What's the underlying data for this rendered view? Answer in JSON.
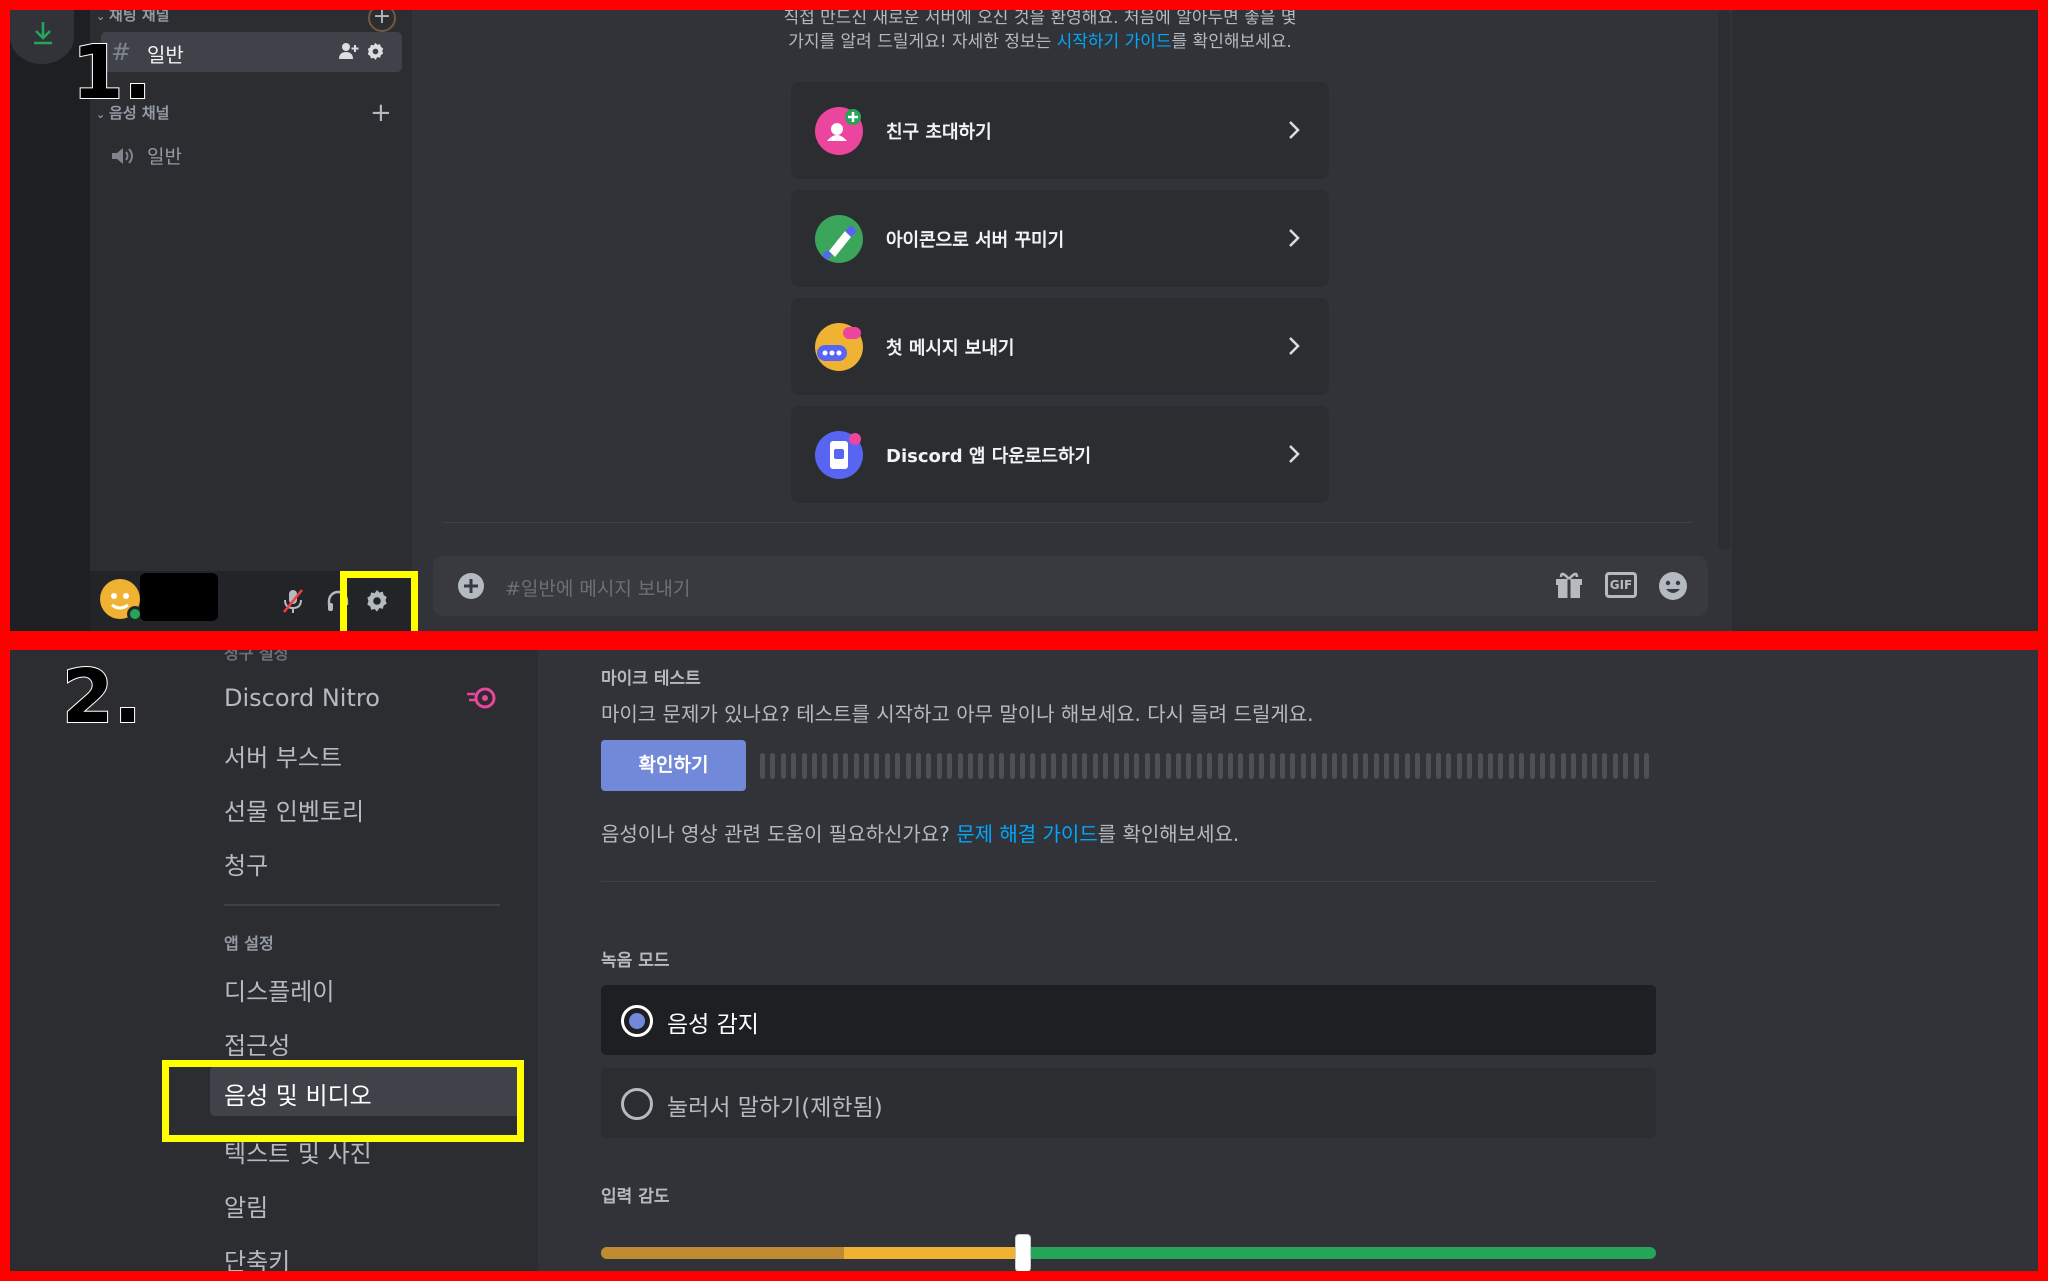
{
  "steps": {
    "one": "1.",
    "two": "2."
  },
  "colors": {
    "frame": "#ff0000",
    "highlight": "#ffff00",
    "accent": "#7289da",
    "link": "#00a8fc",
    "green": "#23a55a"
  },
  "channel_sidebar": {
    "text_category": "채팅 채널",
    "text_channel": "일반",
    "voice_category": "음성 채널",
    "voice_channel": "일반",
    "icons": [
      "download-icon",
      "hash-icon",
      "add-member-icon",
      "gear-icon",
      "plus-icon",
      "speaker-icon"
    ]
  },
  "user_panel": {
    "icons": [
      "avatar",
      "mute-mic-icon",
      "headphones-icon",
      "settings-gear-icon"
    ]
  },
  "chat": {
    "welcome_line1": "직접 만드신 새로운 서버에 오신 것을 환영해요. 처음에 알아두면 좋을 몇",
    "welcome_line2_pre": "가지를 알려   드릴게요! 자세한 정보는 ",
    "welcome_link": "시작하기 가이드",
    "welcome_line2_post": "를 확인해보세요.",
    "cards": [
      {
        "label": "친구 초대하기",
        "icon": "invite-friend-icon"
      },
      {
        "label": "아이콘으로 서버 꾸미기",
        "icon": "customize-server-icon"
      },
      {
        "label": "첫 메시지 보내기",
        "icon": "first-message-icon"
      },
      {
        "label": "Discord 앱 다운로드하기",
        "icon": "download-app-icon"
      }
    ],
    "composer_placeholder": "#일반에 메시지 보내기",
    "gif_label": "GIF"
  },
  "settings_nav": {
    "partial_header": "청구 설정",
    "items_top": [
      "Discord Nitro",
      "서버 부스트",
      "선물 인벤토리",
      "청구"
    ],
    "app_header": "앱 설정",
    "items_app": [
      "디스플레이",
      "접근성",
      "음성 및 비디오",
      "텍스트 및 사진",
      "알림",
      "단축키"
    ],
    "selected": "음성 및 비디오"
  },
  "voice_settings": {
    "mic_test_label": "마이크 테스트",
    "mic_test_desc": "마이크 문제가 있나요? 테스트를 시작하고 아무 말이나 해보세요. 다시 들려 드릴게요.",
    "confirm_button": "확인하기",
    "help_pre": "음성이나 영상 관련 도움이 필요하신가요? ",
    "help_link": "문제 해결 가이드",
    "help_post": "를 확인해보세요.",
    "input_mode_label": "녹음 모드",
    "input_modes": [
      "음성 감지",
      "눌러서 말하기(제한됨)"
    ],
    "selected_mode": "음성 감지",
    "sensitivity_label": "입력 감도",
    "sensitivity_value": 0.4
  }
}
